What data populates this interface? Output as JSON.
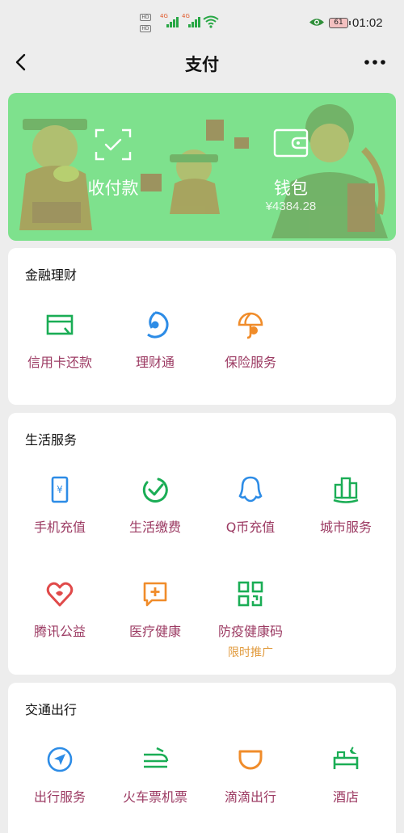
{
  "status_bar": {
    "time": "01:02",
    "battery": "61",
    "network": "4G",
    "hd": "HD"
  },
  "nav": {
    "title": "支付"
  },
  "hero": {
    "collect_label": "收付款",
    "wallet_label": "钱包",
    "wallet_balance": "¥4384.28"
  },
  "sections": {
    "finance": {
      "title": "金融理财",
      "items": [
        {
          "label": "信用卡还款",
          "icon": "credit-card-icon"
        },
        {
          "label": "理财通",
          "icon": "wealth-icon"
        },
        {
          "label": "保险服务",
          "icon": "umbrella-icon"
        }
      ]
    },
    "life": {
      "title": "生活服务",
      "items": [
        {
          "label": "手机充值",
          "icon": "phone-yuan-icon"
        },
        {
          "label": "生活缴费",
          "icon": "check-leaf-icon"
        },
        {
          "label": "Q币充值",
          "icon": "penguin-icon"
        },
        {
          "label": "城市服务",
          "icon": "buildings-icon"
        },
        {
          "label": "腾讯公益",
          "icon": "heart-icon"
        },
        {
          "label": "医疗健康",
          "icon": "medical-icon"
        },
        {
          "label": "防疫健康码",
          "icon": "qr-code-icon",
          "sub": "限时推广"
        }
      ]
    },
    "transport": {
      "title": "交通出行",
      "items": [
        {
          "label": "出行服务",
          "icon": "compass-icon"
        },
        {
          "label": "火车票机票",
          "icon": "train-icon"
        },
        {
          "label": "滴滴出行",
          "icon": "didi-icon"
        },
        {
          "label": "酒店",
          "icon": "bed-icon"
        }
      ]
    }
  },
  "colors": {
    "hero_bg": "#7ee18d",
    "label": "#9c3b63",
    "icon_green": "#1aad55",
    "icon_blue": "#2d8ce6",
    "icon_orange": "#f08c2a",
    "icon_red": "#e04a4a",
    "promo": "#e19a3c"
  }
}
